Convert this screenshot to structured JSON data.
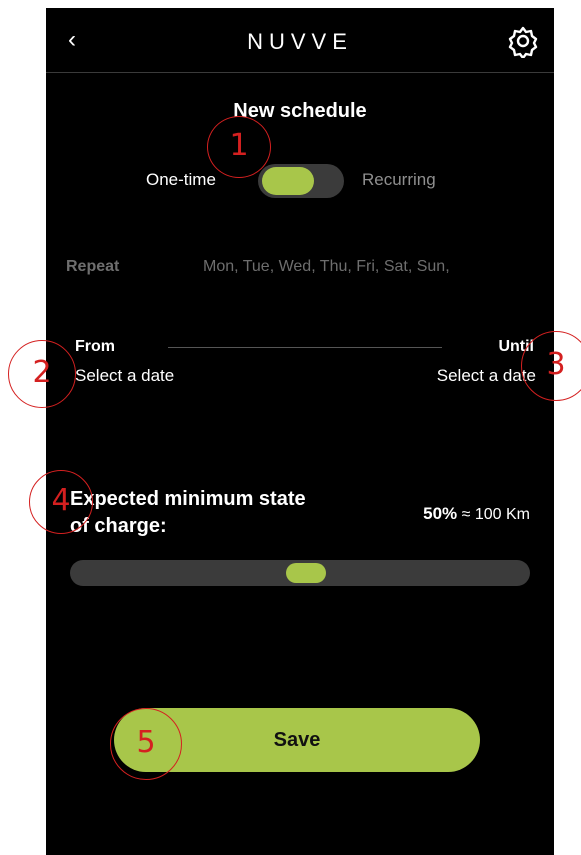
{
  "header": {
    "back_icon": "chevron-left-icon",
    "back_glyph": "‹",
    "logo_text": "NUVVE",
    "settings_icon": "gear-icon"
  },
  "page": {
    "title": "New schedule"
  },
  "mode": {
    "one_time_label": "One-time",
    "recurring_label": "Recurring",
    "selected": "One-time"
  },
  "repeat": {
    "label": "Repeat",
    "days": "Mon, Tue, Wed, Thu, Fri, Sat, Sun,"
  },
  "dates": {
    "from_label": "From",
    "from_value": "Select a date",
    "until_label": "Until",
    "until_value": "Select a date"
  },
  "charge": {
    "label": "Expected minimum state of charge:",
    "percent_text": "50%",
    "range_text": "≈ 100 Km",
    "level": 0.5
  },
  "save": {
    "label": "Save"
  },
  "annotations": [
    "1",
    "2",
    "3",
    "4",
    "5"
  ],
  "colors": {
    "accent": "#a8c64a",
    "background": "#000000",
    "annotation": "#d42020",
    "muted_text": "#6e6e6e"
  }
}
